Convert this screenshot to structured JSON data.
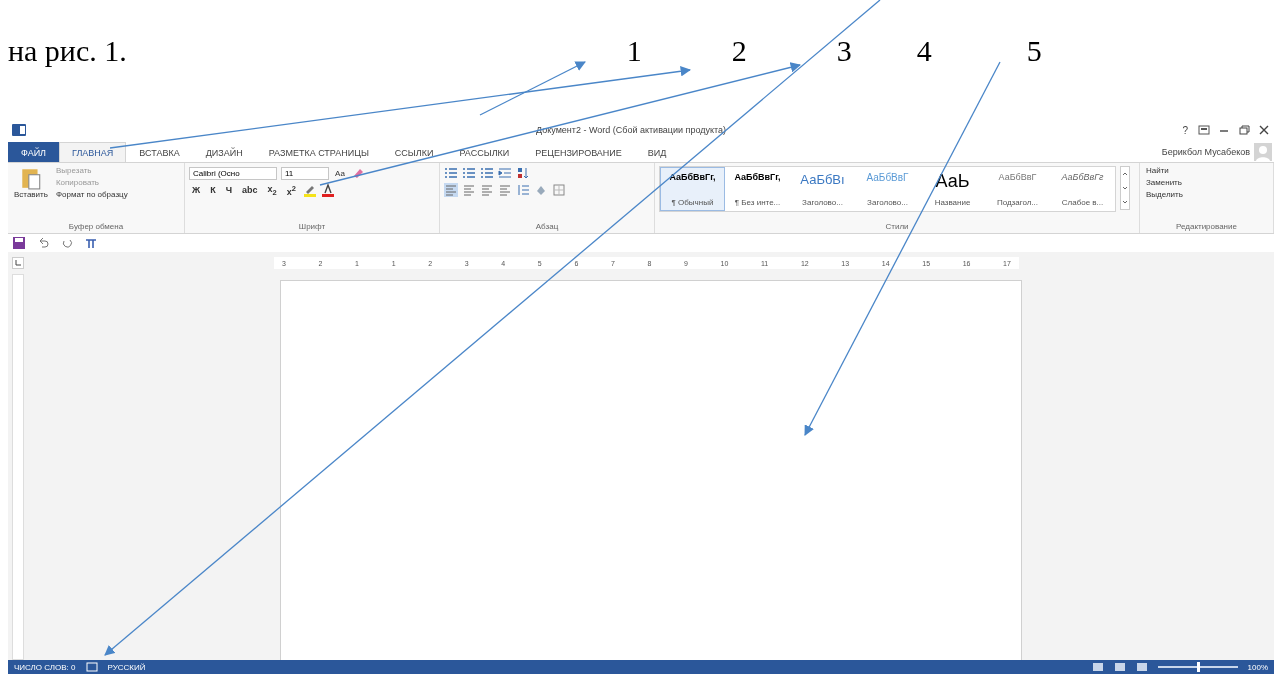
{
  "page_text": {
    "line": "на рис. 1.",
    "callouts": [
      "1",
      "2",
      "3",
      "4",
      "5"
    ]
  },
  "window": {
    "title": "Документ2 - Word (Сбой активации продукта)",
    "help": "?",
    "user": "Берикбол Мусабеков"
  },
  "tabs": [
    {
      "label": "ФАЙЛ",
      "selected": false,
      "kind": "file"
    },
    {
      "label": "ГЛАВНАЯ",
      "selected": true,
      "kind": "tab"
    },
    {
      "label": "ВСТАВКА",
      "selected": false,
      "kind": "tab"
    },
    {
      "label": "ДИЗАЙН",
      "selected": false,
      "kind": "tab"
    },
    {
      "label": "РАЗМЕТКА СТРАНИЦЫ",
      "selected": false,
      "kind": "tab"
    },
    {
      "label": "ССЫЛКИ",
      "selected": false,
      "kind": "tab"
    },
    {
      "label": "РАССЫЛКИ",
      "selected": false,
      "kind": "tab"
    },
    {
      "label": "РЕЦЕНЗИРОВАНИЕ",
      "selected": false,
      "kind": "tab"
    },
    {
      "label": "ВИД",
      "selected": false,
      "kind": "tab"
    }
  ],
  "clipboard": {
    "title": "Буфер обмена",
    "paste": "Вставить",
    "cut": "Вырезать",
    "copy": "Копировать",
    "format_painter": "Формат по образцу"
  },
  "font": {
    "title": "Шрифт",
    "font_name": "Calibri (Осно",
    "font_size": "11",
    "change_case": "Аа",
    "format_buttons": [
      "Ж",
      "К",
      "Ч",
      "abc",
      "x$_{2}$",
      "x$^{2}$"
    ]
  },
  "paragraph": {
    "title": "Абзац",
    "alignments": [
      {
        "selected": true
      },
      {
        "selected": false
      },
      {
        "selected": false
      },
      {
        "selected": false
      }
    ]
  },
  "styles": {
    "title": "Стили",
    "items": [
      {
        "preview": "АаБбВвГг,",
        "name": "¶ Обычный",
        "selected": true,
        "kind": "bold"
      },
      {
        "preview": "АаБбВвГг,",
        "name": "¶ Без инте...",
        "selected": false,
        "kind": "bold"
      },
      {
        "preview": "АаБбВı",
        "name": "Заголово...",
        "selected": false,
        "kind": "heading"
      },
      {
        "preview": "АаБбВвГ",
        "name": "Заголово...",
        "selected": false,
        "kind": "heading2"
      },
      {
        "preview": "АаЬ",
        "name": "Название",
        "selected": false,
        "kind": "title"
      },
      {
        "preview": "АаБбВвГ",
        "name": "Подзагол...",
        "selected": false,
        "kind": "subtle"
      },
      {
        "preview": "АаБбВвГг",
        "name": "Слабое в...",
        "selected": false,
        "kind": "emphasis"
      }
    ]
  },
  "editing": {
    "title": "Редактирование",
    "find": "Найти",
    "replace": "Заменить",
    "select": "Выделить"
  },
  "ruler": {
    "labels": [
      "3",
      "2",
      "1",
      "1",
      "2",
      "3",
      "4",
      "5",
      "6",
      "7",
      "8",
      "9",
      "10",
      "11",
      "12",
      "13",
      "14",
      "15",
      "16",
      "17"
    ]
  },
  "status_bar": {
    "word_count": "ЧИСЛО СЛОВ: 0",
    "language": "РУССКИЙ",
    "zoom": "100%",
    "level": 0.5
  }
}
